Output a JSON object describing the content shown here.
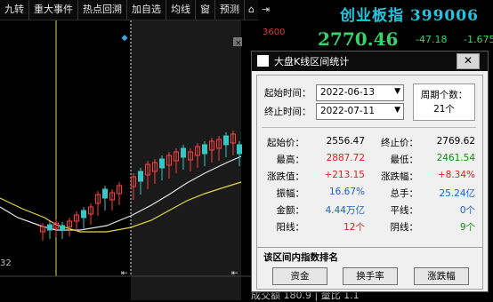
{
  "toolbar": {
    "items": [
      "九转",
      "重大事件",
      "热点回溯",
      "加自选",
      "均线",
      "窗",
      "预测"
    ]
  },
  "chart": {
    "left_axis_value": "32",
    "right_axis_value": "3600"
  },
  "quote": {
    "name": "创业板指",
    "code": "399006",
    "price": "2770.46",
    "change": "-47.18",
    "change_pct": "-1.675"
  },
  "background_text": "成交额  180.9  | 量比  1.1",
  "dialog": {
    "title": "大盘K线区间统计",
    "start_label": "起始时间：",
    "start_value": "2022-06-13",
    "end_label": "终止时间：",
    "end_value": "2022-07-11",
    "period_label": "周期个数：",
    "period_value": "21个",
    "stats": {
      "start_price_label": "起始价：",
      "start_price": "2556.47",
      "end_price_label": "终止价：",
      "end_price": "2769.62",
      "high_label": "最高：",
      "high": "2887.72",
      "low_label": "最低：",
      "low": "2461.54",
      "chg_label": "涨跌值：",
      "chg": "+213.15",
      "chg_pct_label": "涨跌幅：",
      "chg_pct": "+8.34%",
      "amp_label": "振幅：",
      "amp": "16.67%",
      "turnover_label": "总手：",
      "turnover": "25.24亿",
      "amount_label": "金额：",
      "amount": "4.44万亿",
      "flat_label": "平线：",
      "flat": "0个",
      "up_label": "阳线：",
      "up": "12个",
      "down_label": "阴线：",
      "down": "9个"
    },
    "rank_title": "该区间内指数排名",
    "buttons": [
      "资金",
      "换手率",
      "涨跌幅"
    ]
  },
  "colors": {
    "up": "#e02020",
    "down": "#148c14",
    "accent": "#1e5fc8"
  }
}
